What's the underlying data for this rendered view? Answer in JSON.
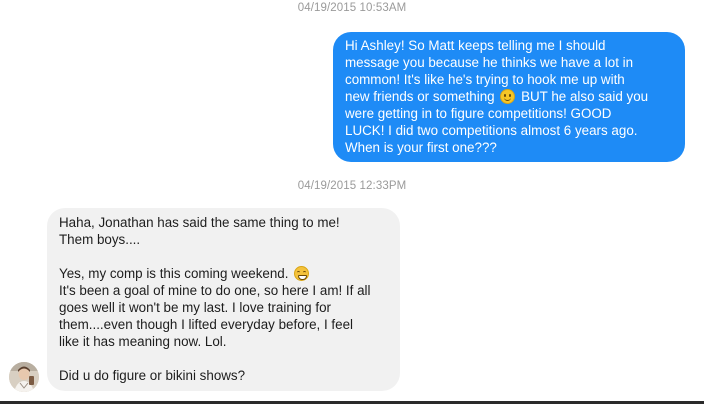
{
  "thread": {
    "timestamps": [
      "04/19/2015 10:53AM",
      "04/19/2015 12:33PM"
    ],
    "messages": [
      {
        "direction": "sent",
        "bubble_color": "#1e8bf6",
        "lines": [
          "Hi Ashley!  So Matt keeps telling me I should",
          "message you because he thinks we have a lot in",
          "common!  It's like he's trying to hook me up with",
          "new friends or something",
          "BUT he also said you",
          "were getting in to figure competitions!  GOOD",
          "LUCK!  I did two competitions almost 6 years ago.",
          "When is your first one???"
        ],
        "inline_emoji": "smiling-face-emoji"
      },
      {
        "direction": "received",
        "bubble_color": "#f1f1f1",
        "lines": [
          "Haha, Jonathan has said the same thing to me!",
          "Them boys....",
          "",
          "Yes, my comp is this coming weekend.",
          "It's been a goal of mine to do one, so here I am! If all",
          "goes well it won't be my last.  I love training for",
          "them....even though I lifted everyday before, I feel",
          "like it has meaning now. Lol.",
          "",
          "Did u do figure or bikini shows?"
        ],
        "inline_emoji": "grinning-face-emoji"
      }
    ],
    "sender_avatar": "contact-avatar"
  }
}
